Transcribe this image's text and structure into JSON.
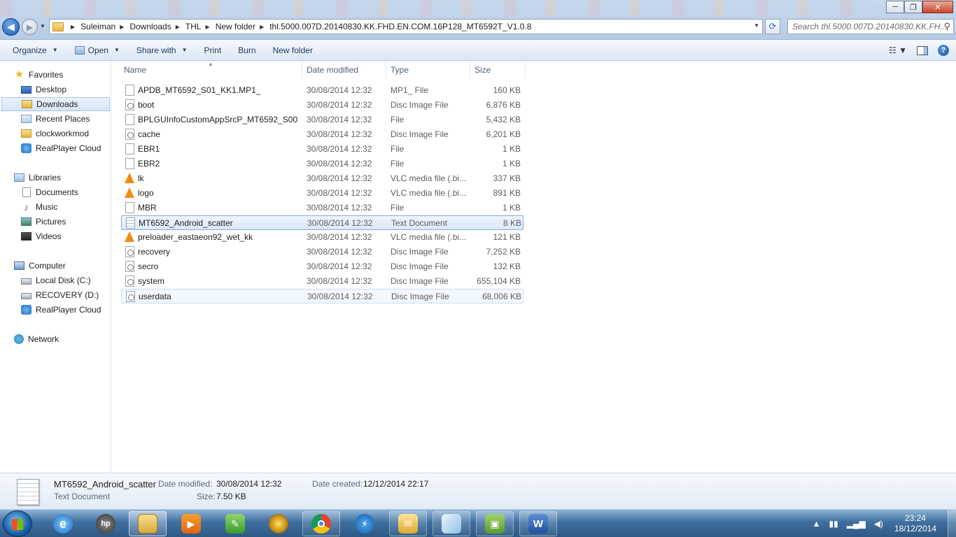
{
  "window": {
    "minimize": "─",
    "maximize": "❐",
    "close": "✕"
  },
  "address": {
    "crumbs": [
      "Suleiman",
      "Downloads",
      "THL",
      "New folder",
      "thl.5000.007D.20140830.KK.FHD.EN.COM.16P128_MT6592T_V1.0.8"
    ]
  },
  "search": {
    "placeholder": "Search thl.5000.007D.20140830.KK.FH..."
  },
  "toolbar": {
    "organize": "Organize",
    "open": "Open",
    "share_with": "Share with",
    "print": "Print",
    "burn": "Burn",
    "new_folder": "New folder"
  },
  "nav": {
    "favorites": "Favorites",
    "desktop": "Desktop",
    "downloads": "Downloads",
    "recent_places": "Recent Places",
    "clockworkmod": "clockworkmod",
    "realplayer_cloud": "RealPlayer Cloud",
    "libraries": "Libraries",
    "documents": "Documents",
    "music": "Music",
    "pictures": "Pictures",
    "videos": "Videos",
    "computer": "Computer",
    "local_disk": "Local Disk (C:)",
    "recovery": "RECOVERY (D:)",
    "realplayer_cloud2": "RealPlayer Cloud",
    "network": "Network"
  },
  "columns": {
    "name": "Name",
    "date": "Date modified",
    "type": "Type",
    "size": "Size"
  },
  "files": [
    {
      "name": "APDB_MT6592_S01_KK1.MP1_",
      "date": "30/08/2014 12:32",
      "type": "MP1_ File",
      "size": "160 KB",
      "icon": "generic"
    },
    {
      "name": "boot",
      "date": "30/08/2014 12:32",
      "type": "Disc Image File",
      "size": "6,876 KB",
      "icon": "disc"
    },
    {
      "name": "BPLGUInfoCustomAppSrcP_MT6592_S00...",
      "date": "30/08/2014 12:32",
      "type": "File",
      "size": "5,432 KB",
      "icon": "generic"
    },
    {
      "name": "cache",
      "date": "30/08/2014 12:32",
      "type": "Disc Image File",
      "size": "6,201 KB",
      "icon": "disc"
    },
    {
      "name": "EBR1",
      "date": "30/08/2014 12:32",
      "type": "File",
      "size": "1 KB",
      "icon": "generic"
    },
    {
      "name": "EBR2",
      "date": "30/08/2014 12:32",
      "type": "File",
      "size": "1 KB",
      "icon": "generic"
    },
    {
      "name": "lk",
      "date": "30/08/2014 12:32",
      "type": "VLC media file (.bi...",
      "size": "337 KB",
      "icon": "vlc"
    },
    {
      "name": "logo",
      "date": "30/08/2014 12:32",
      "type": "VLC media file (.bi...",
      "size": "891 KB",
      "icon": "vlc"
    },
    {
      "name": "MBR",
      "date": "30/08/2014 12:32",
      "type": "File",
      "size": "1 KB",
      "icon": "generic"
    },
    {
      "name": "MT6592_Android_scatter",
      "date": "30/08/2014 12:32",
      "type": "Text Document",
      "size": "8 KB",
      "icon": "text"
    },
    {
      "name": "preloader_eastaeon92_wet_kk",
      "date": "30/08/2014 12:32",
      "type": "VLC media file (.bi...",
      "size": "121 KB",
      "icon": "vlc"
    },
    {
      "name": "recovery",
      "date": "30/08/2014 12:32",
      "type": "Disc Image File",
      "size": "7,252 KB",
      "icon": "disc"
    },
    {
      "name": "secro",
      "date": "30/08/2014 12:32",
      "type": "Disc Image File",
      "size": "132 KB",
      "icon": "disc"
    },
    {
      "name": "system",
      "date": "30/08/2014 12:32",
      "type": "Disc Image File",
      "size": "655,104 KB",
      "icon": "disc"
    },
    {
      "name": "userdata",
      "date": "30/08/2014 12:32",
      "type": "Disc Image File",
      "size": "68,006 KB",
      "icon": "disc"
    }
  ],
  "selected_index": 9,
  "hover_index": 14,
  "details": {
    "name": "MT6592_Android_scatter",
    "type": "Text Document",
    "date_modified_label": "Date modified:",
    "date_modified": "30/08/2014 12:32",
    "size_label": "Size:",
    "size": "7.50 KB",
    "date_created_label": "Date created:",
    "date_created": "12/12/2014 22:17"
  },
  "taskbar": {
    "time": "23:24",
    "date": "18/12/2014"
  }
}
